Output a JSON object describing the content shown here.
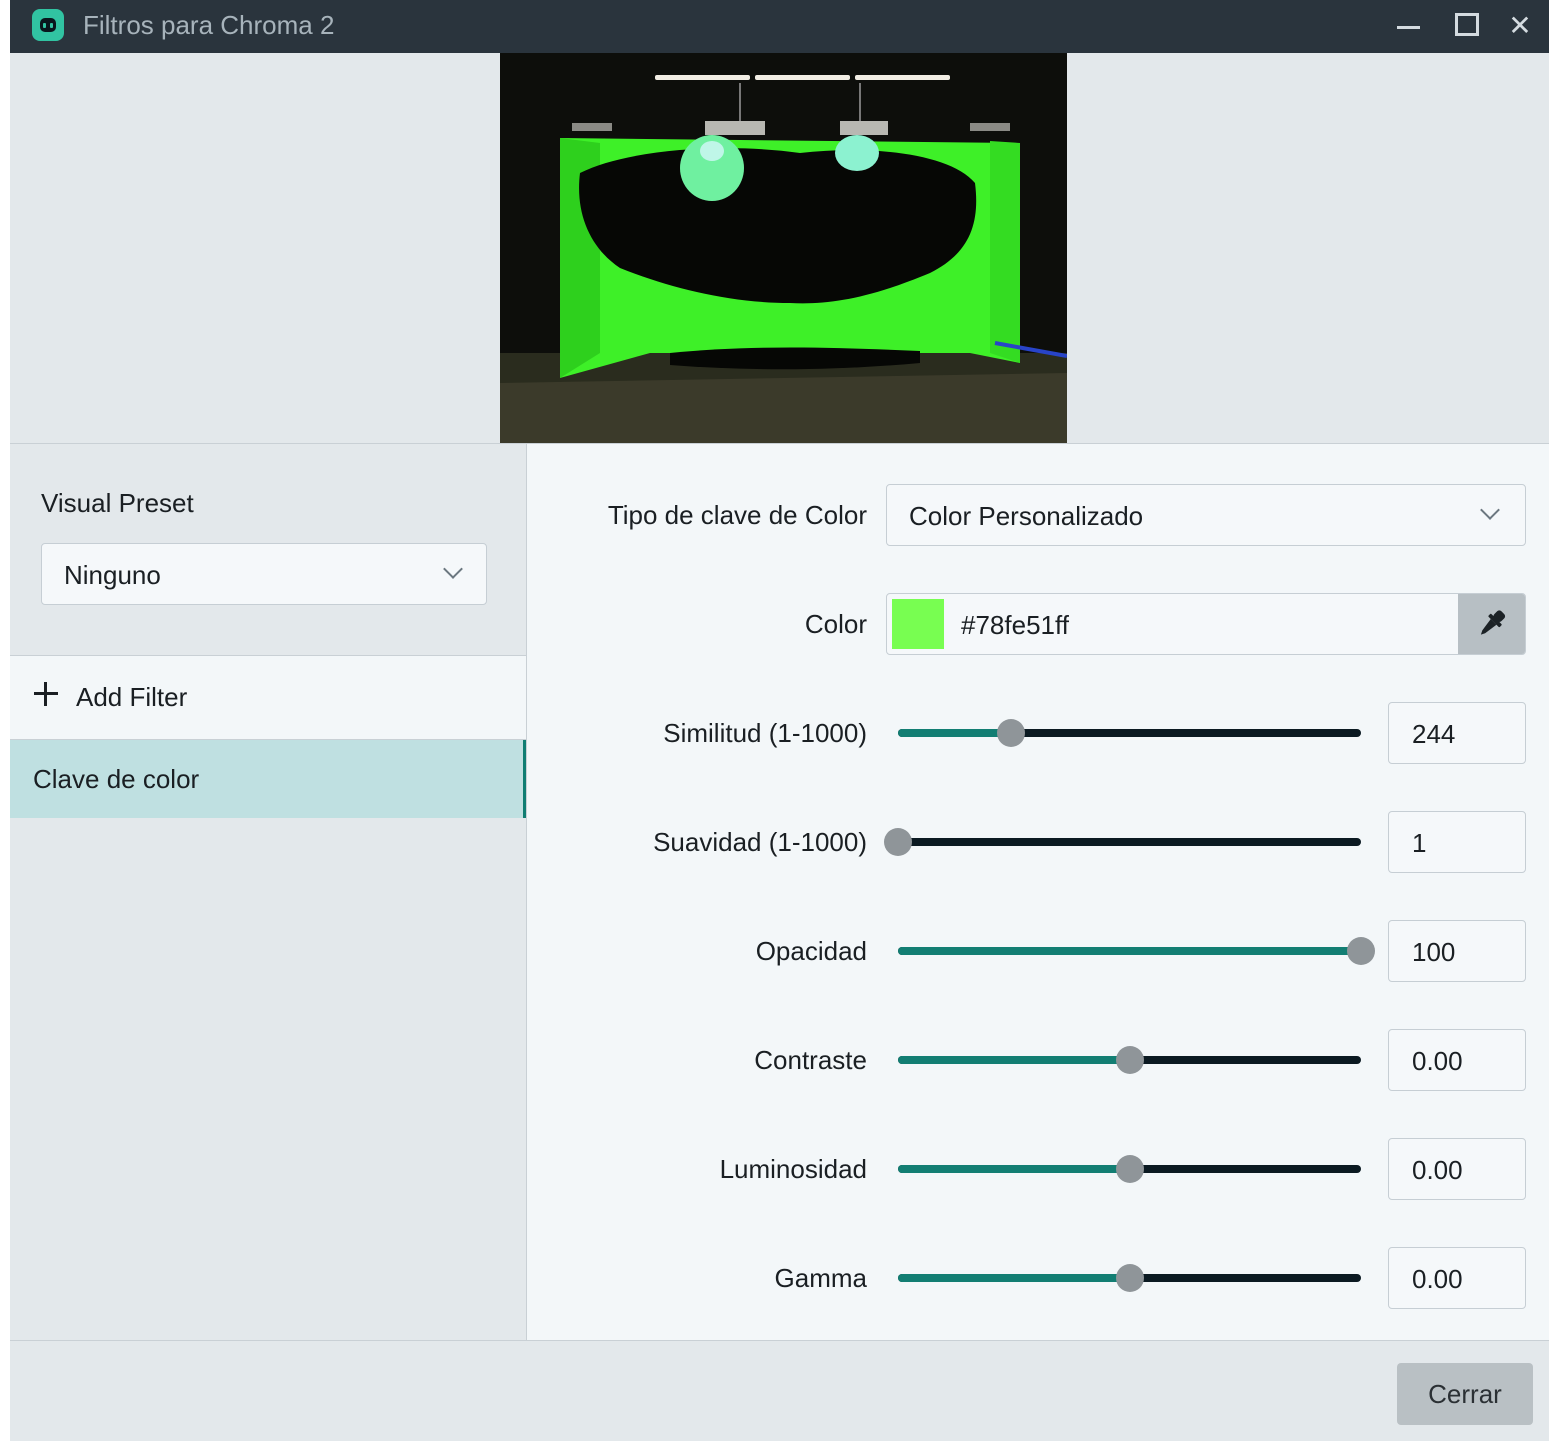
{
  "window": {
    "title": "Filtros para Chroma 2"
  },
  "left": {
    "preset_label": "Visual Preset",
    "preset_value": "Ninguno",
    "add_filter_label": "Add Filter",
    "filters": [
      {
        "label": "Clave de color",
        "selected": true
      }
    ]
  },
  "settings": {
    "key_type": {
      "label": "Tipo de clave de Color",
      "value": "Color Personalizado"
    },
    "color": {
      "label": "Color",
      "value": "#78fe51ff",
      "swatch": "#78fe51"
    },
    "sliders": [
      {
        "label": "Similitud (1-1000)",
        "value": "244",
        "level": 0.244
      },
      {
        "label": "Suavidad (1-1000)",
        "value": "1",
        "level": 0.0
      },
      {
        "label": "Opacidad",
        "value": "100",
        "level": 1.0
      },
      {
        "label": "Contraste",
        "value": "0.00",
        "level": 0.5
      },
      {
        "label": "Luminosidad",
        "value": "0.00",
        "level": 0.5
      },
      {
        "label": "Gamma",
        "value": "0.00",
        "level": 0.5
      }
    ]
  },
  "footer": {
    "close_label": "Cerrar"
  },
  "colors": {
    "accent": "#127e73",
    "selected_bg": "#bfe0e1",
    "chroma_green": "#3ef028"
  }
}
